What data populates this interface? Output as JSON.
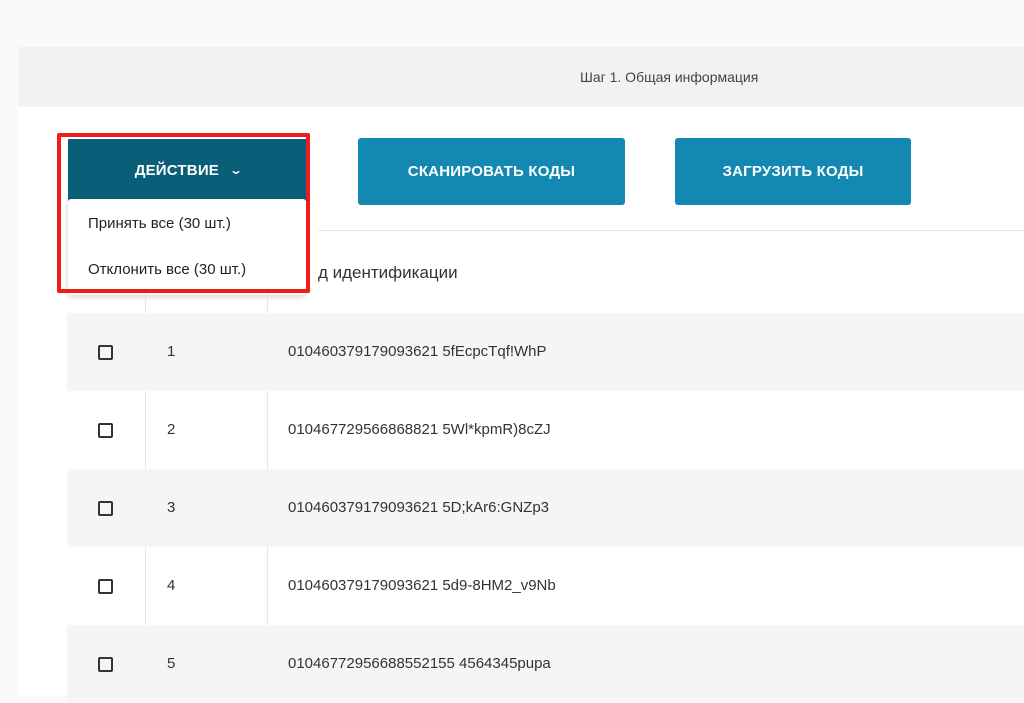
{
  "step_header": {
    "title": "Шаг 1. Общая информация"
  },
  "toolbar": {
    "action_label": "ДЕЙСТВИЕ",
    "action_icon": "chevron-down-icon",
    "scan_label": "СКАНИРОВАТЬ КОДЫ",
    "load_label": "ЗАГРУЗИТЬ КОДЫ"
  },
  "dropdown": {
    "items": [
      {
        "label": "Принять все (30 шт.)"
      },
      {
        "label": "Отклонить все (30 шт.)"
      }
    ]
  },
  "table": {
    "column_header": "д идентификации",
    "rows": [
      {
        "num": "1",
        "code": "010460379179093621 5fEcpcTqf!WhP"
      },
      {
        "num": "2",
        "code": "010467729566868821 5Wl*kpmR)8cZJ"
      },
      {
        "num": "3",
        "code": "010460379179093621 5D;kAr6:GNZp3"
      },
      {
        "num": "4",
        "code": "010460379179093621 5d9-8HM2_v9Nb"
      },
      {
        "num": "5",
        "code": "01046772956688552155 4564345pupa"
      }
    ]
  },
  "colors": {
    "button": "#1288b3",
    "action_button": "#0a5f78",
    "highlight": "#ee1c1c"
  }
}
